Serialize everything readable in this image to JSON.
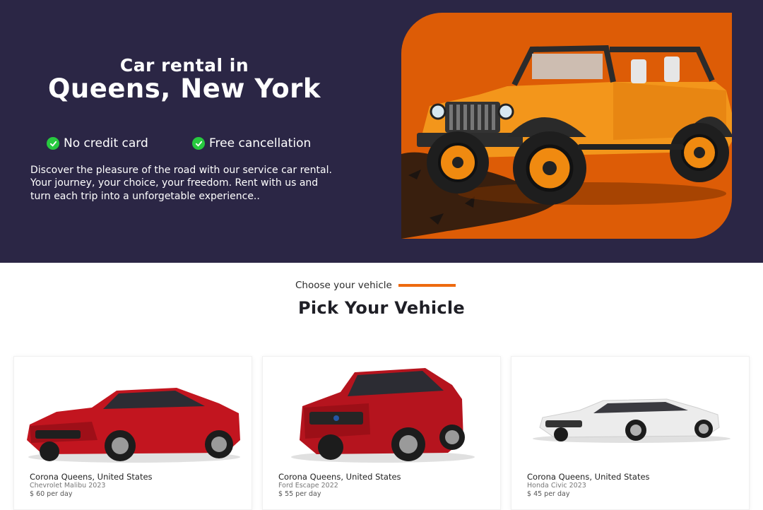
{
  "hero": {
    "title_line1": "Car rental in",
    "title_line2": "Queens, New York",
    "features": [
      "No credit card",
      "Free cancellation"
    ],
    "description": "Discover the pleasure of the road with our service car rental. Your journey, your choice, your freedom. Rent with us and turn each trip into a unforgetable experience..",
    "image_icon": "jeep-car-image"
  },
  "section": {
    "eyebrow": "Choose your vehicle",
    "title": "Pick Your Vehicle"
  },
  "vehicles": [
    {
      "location": "Corona Queens, United States",
      "model": "Chevrolet Malibu 2023",
      "price": "$ 60 per day",
      "color": "#c2151f"
    },
    {
      "location": "Corona Queens, United States",
      "model": "Ford Escape 2022",
      "price": "$ 55 per day",
      "color": "#b5141e"
    },
    {
      "location": "Corona Queens, United States",
      "model": "Honda Civic 2023",
      "price": "$ 45 per day",
      "color": "#ececec"
    }
  ],
  "colors": {
    "hero_bg": "#2b2645",
    "accent_orange": "#dd5c06",
    "check_green": "#27c93f"
  }
}
